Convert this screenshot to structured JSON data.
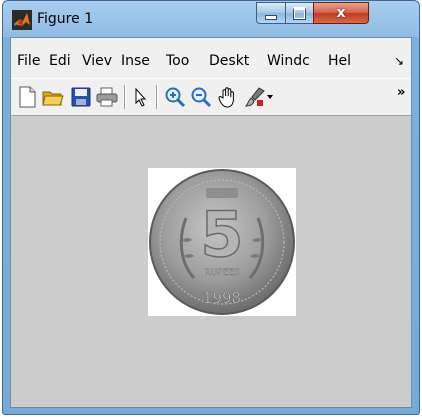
{
  "window": {
    "title": "Figure 1",
    "close_label": "x"
  },
  "menubar": {
    "items": [
      "File",
      "Edi",
      "Viev",
      "Inse",
      "Too",
      "Deskt",
      "Windc",
      "Hel"
    ],
    "overflow_icon": "chevron-right-icon"
  },
  "toolbar": {
    "buttons": [
      {
        "name": "new-figure-icon"
      },
      {
        "name": "open-file-icon"
      },
      {
        "name": "save-icon"
      },
      {
        "name": "print-icon"
      },
      {
        "name": "edit-plot-arrow-icon"
      },
      {
        "name": "zoom-in-icon"
      },
      {
        "name": "zoom-out-icon"
      },
      {
        "name": "pan-hand-icon"
      },
      {
        "name": "data-brush-icon"
      }
    ],
    "overflow_label": "»"
  },
  "image": {
    "content": "grayscale coin",
    "coin_numeral": "5",
    "coin_year": "1998",
    "coin_text": "RUPEES"
  },
  "colors": {
    "canvas_bg": "#cccccc",
    "titlebar": "#8fbbe4",
    "close_button": "#c23a1f"
  }
}
